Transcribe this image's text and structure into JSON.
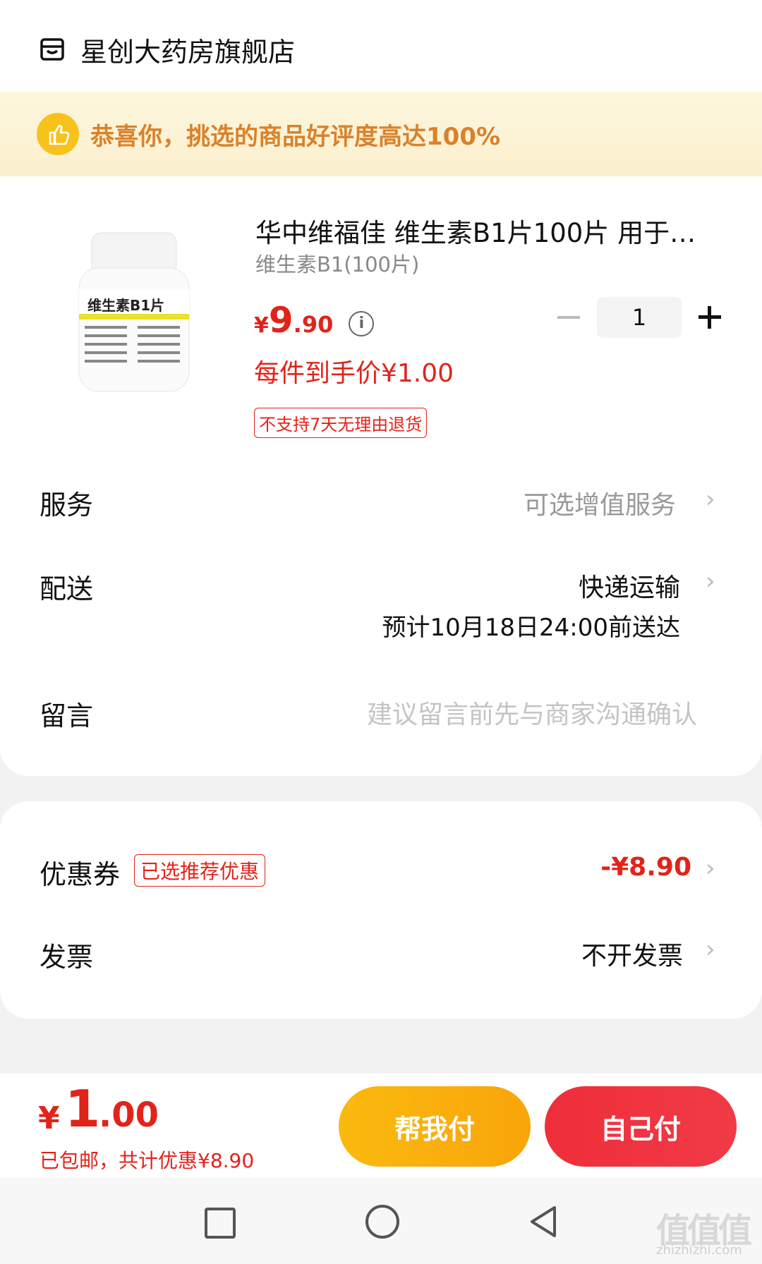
{
  "store": {
    "name": "星创大药房旗舰店",
    "icon": "store-icon"
  },
  "banner": {
    "text": "恭喜你，挑选的商品好评度高达100%",
    "icon": "thumbs-up-icon"
  },
  "product": {
    "title": "华中维福佳 维生素B1片100片 用于…",
    "spec": "维生素B1(100片)",
    "image_label": "维生素B1片",
    "price_symbol": "¥",
    "price_int": "9",
    "price_dec": ".90",
    "quantity": "1",
    "unit_price": "每件到手价¥1.00",
    "return_policy": "不支持7天无理由退货"
  },
  "rows": {
    "service_label": "服务",
    "service_value": "可选增值服务",
    "delivery_label": "配送",
    "delivery_value": "快递运输",
    "delivery_eta": "预计10月18日24:00前送达",
    "message_label": "留言",
    "message_placeholder": "建议留言前先与商家沟通确认",
    "coupon_label": "优惠券",
    "coupon_tag": "已选推荐优惠",
    "coupon_value": "-¥8.90",
    "invoice_label": "发票",
    "invoice_value": "不开发票"
  },
  "footer": {
    "total_symbol": "¥",
    "total_int": "1",
    "total_dec": ".00",
    "note": "已包邮，共计优惠¥8.90",
    "help_pay": "帮我付",
    "self_pay": "自己付"
  },
  "watermark": {
    "text": "值值值",
    "url": "zhizhizhi.com"
  },
  "colors": {
    "accent_red": "#e2231a",
    "banner_text": "#d9822b",
    "help_button": "#fbb90f",
    "self_button": "#ef2e3a"
  }
}
